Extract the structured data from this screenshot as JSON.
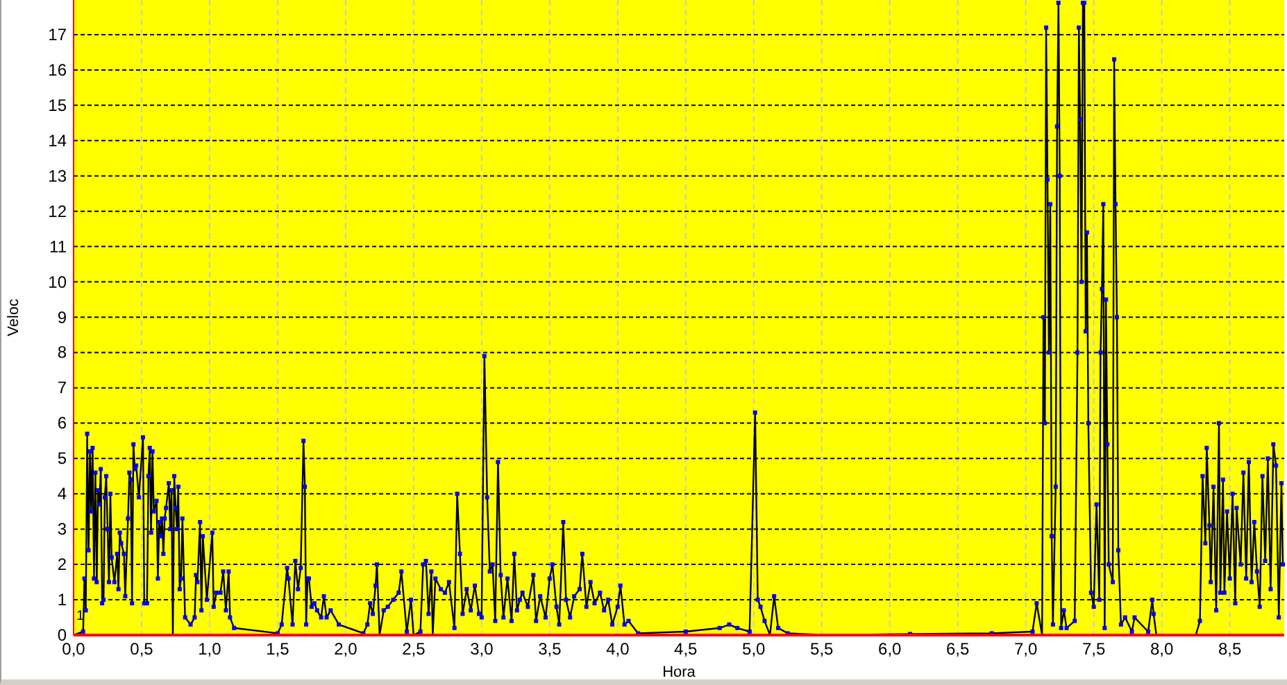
{
  "chart_data": {
    "type": "line",
    "xlabel": "Hora",
    "ylabel": "Veloc",
    "xlim": [
      0,
      8.9
    ],
    "ylim": [
      0,
      18
    ],
    "xticks": [
      {
        "value": 0,
        "label": "0,0"
      },
      {
        "value": 0.5,
        "label": "0,5"
      },
      {
        "value": 1,
        "label": "1,0"
      },
      {
        "value": 1.5,
        "label": "1,5"
      },
      {
        "value": 2,
        "label": "2,0"
      },
      {
        "value": 2.5,
        "label": "2,5"
      },
      {
        "value": 3,
        "label": "3,0"
      },
      {
        "value": 3.5,
        "label": "3,5"
      },
      {
        "value": 4,
        "label": "4,0"
      },
      {
        "value": 4.5,
        "label": "4,5"
      },
      {
        "value": 5,
        "label": "5,0"
      },
      {
        "value": 5.5,
        "label": "5,5"
      },
      {
        "value": 6,
        "label": "6,0"
      },
      {
        "value": 6.5,
        "label": "6,5"
      },
      {
        "value": 7,
        "label": "7,0"
      },
      {
        "value": 7.5,
        "label": "7,5"
      },
      {
        "value": 8,
        "label": "8,0"
      },
      {
        "value": 8.5,
        "label": "8,5"
      }
    ],
    "yticks": [
      0,
      1,
      2,
      3,
      4,
      5,
      6,
      7,
      8,
      9,
      10,
      11,
      12,
      13,
      14,
      15,
      16,
      17
    ],
    "x": [
      0,
      0.07,
      0.08,
      0.09,
      0.1,
      0.11,
      0.12,
      0.13,
      0.14,
      0.15,
      0.16,
      0.17,
      0.18,
      0.19,
      0.2,
      0.21,
      0.22,
      0.23,
      0.24,
      0.25,
      0.26,
      0.27,
      0.28,
      0.3,
      0.32,
      0.33,
      0.34,
      0.35,
      0.37,
      0.38,
      0.4,
      0.41,
      0.42,
      0.43,
      0.44,
      0.45,
      0.46,
      0.48,
      0.51,
      0.52,
      0.54,
      0.55,
      0.56,
      0.57,
      0.58,
      0.59,
      0.61,
      0.62,
      0.63,
      0.64,
      0.65,
      0.66,
      0.67,
      0.68,
      0.7,
      0.71,
      0.72,
      0.73,
      0.74,
      0.75,
      0.76,
      0.77,
      0.78,
      0.79,
      0.8,
      0.82,
      0.86,
      0.89,
      0.9,
      0.91,
      0.93,
      0.94,
      0.95,
      0.98,
      1.02,
      1.03,
      1.05,
      1.08,
      1.1,
      1.12,
      1.14,
      1.15,
      1.18,
      1.5,
      1.53,
      1.57,
      1.58,
      1.61,
      1.63,
      1.65,
      1.67,
      1.69,
      1.7,
      1.71,
      1.72,
      1.73,
      1.75,
      1.77,
      1.79,
      1.82,
      1.84,
      1.86,
      1.89,
      1.95,
      2.13,
      2.16,
      2.18,
      2.2,
      2.22,
      2.23,
      2.25,
      2.28,
      2.31,
      2.35,
      2.39,
      2.41,
      2.45,
      2.48,
      2.5,
      2.55,
      2.57,
      2.59,
      2.61,
      2.63,
      2.64,
      2.66,
      2.7,
      2.73,
      2.76,
      2.8,
      2.82,
      2.84,
      2.86,
      2.89,
      2.92,
      2.95,
      2.98,
      3,
      3.02,
      3.04,
      3.06,
      3.08,
      3.1,
      3.12,
      3.14,
      3.16,
      3.19,
      3.22,
      3.24,
      3.26,
      3.28,
      3.3,
      3.34,
      3.38,
      3.4,
      3.43,
      3.47,
      3.5,
      3.52,
      3.55,
      3.57,
      3.6,
      3.62,
      3.65,
      3.68,
      3.72,
      3.74,
      3.77,
      3.8,
      3.83,
      3.87,
      3.9,
      3.93,
      3.96,
      4,
      4.02,
      4.05,
      4.08,
      4.15,
      4.5,
      4.75,
      4.82,
      4.88,
      4.97,
      5.01,
      5.03,
      5.05,
      5.08,
      5.12,
      5.15,
      5.18,
      5.25,
      5.55,
      6.15,
      6.75,
      7.05,
      7.08,
      7.12,
      7.13,
      7.14,
      7.15,
      7.16,
      7.17,
      7.18,
      7.19,
      7.2,
      7.22,
      7.23,
      7.24,
      7.25,
      7.26,
      7.28,
      7.3,
      7.36,
      7.38,
      7.39,
      7.4,
      7.41,
      7.42,
      7.43,
      7.44,
      7.45,
      7.46,
      7.48,
      7.5,
      7.52,
      7.54,
      7.55,
      7.56,
      7.57,
      7.58,
      7.59,
      7.6,
      7.61,
      7.64,
      7.65,
      7.66,
      7.67,
      7.68,
      7.7,
      7.73,
      7.78,
      7.8,
      7.9,
      7.93,
      7.94,
      7.96,
      8.25,
      8.28,
      8.3,
      8.32,
      8.33,
      8.35,
      8.36,
      8.38,
      8.4,
      8.42,
      8.43,
      8.45,
      8.46,
      8.48,
      8.5,
      8.52,
      8.54,
      8.55,
      8.58,
      8.6,
      8.62,
      8.64,
      8.66,
      8.68,
      8.7,
      8.72,
      8.74,
      8.76,
      8.78,
      8.8,
      8.82,
      8.84,
      8.86,
      8.88,
      8.89
    ],
    "grid": true,
    "series": [
      {
        "name": "1",
        "color": "#000000",
        "marker": "square",
        "values": [
          0,
          0.1,
          1.6,
          0.7,
          5.7,
          2.4,
          5.2,
          3.5,
          5.3,
          1.6,
          4.6,
          1.5,
          4.1,
          3.7,
          4.7,
          0.9,
          1,
          3.9,
          4.5,
          3,
          1.5,
          4,
          2.2,
          1.5,
          2.3,
          1.3,
          2.9,
          2.6,
          2.3,
          1.1,
          3.3,
          4.6,
          4.4,
          0.9,
          5.4,
          4.7,
          4.8,
          3.9,
          5.6,
          0.9,
          0.9,
          4.5,
          5.3,
          2.9,
          5.2,
          3.5,
          3.8,
          1.6,
          3.2,
          2.8,
          3.3,
          2.3,
          3.3,
          3.6,
          4.3,
          3,
          4.1,
          0,
          4.5,
          3.6,
          3,
          4.2,
          1.3,
          1.6,
          3.3,
          0.5,
          0.3,
          0.5,
          1.7,
          1.5,
          3.2,
          0.7,
          2.8,
          1,
          2.9,
          0.8,
          1.2,
          1.2,
          1.8,
          0.7,
          1.8,
          0.5,
          0.2,
          0.05,
          0.3,
          1.9,
          1.6,
          0.3,
          2.1,
          1.3,
          1.9,
          5.5,
          4.2,
          0.3,
          1.6,
          1.6,
          0.8,
          0.9,
          0.7,
          0.5,
          1.1,
          0.5,
          0.7,
          0.3,
          0.05,
          0.3,
          0.9,
          0.6,
          1.4,
          2,
          0,
          0.7,
          0.8,
          1,
          1.2,
          1.8,
          0.1,
          1,
          0,
          0.1,
          2,
          2.1,
          0.6,
          1.8,
          0,
          1.6,
          1.3,
          1.2,
          1.5,
          0.2,
          4,
          2.3,
          0.6,
          1.3,
          0.7,
          1.4,
          0.6,
          0.5,
          7.9,
          3.9,
          1.8,
          2,
          0.4,
          4.9,
          1.7,
          0.5,
          1.6,
          0.4,
          2.3,
          0.7,
          1,
          1.2,
          0.8,
          1.7,
          0.4,
          1.1,
          0.5,
          1.6,
          2,
          0.8,
          0.3,
          3.2,
          1,
          0.5,
          1.1,
          1.3,
          2.3,
          0.8,
          1.5,
          0.9,
          1.2,
          0.7,
          1,
          0.3,
          0.8,
          1.4,
          0.3,
          0.4,
          0.05,
          0.1,
          0.2,
          0.3,
          0.2,
          0.1,
          6.3,
          1,
          0.8,
          0.4,
          0,
          1.1,
          0.2,
          0.05,
          0,
          0.03,
          0.05,
          0.1,
          0.9,
          0,
          9,
          6,
          17.2,
          12.9,
          8,
          12.2,
          2.8,
          0.3,
          4.2,
          14.4,
          17.9,
          13,
          0.2,
          0.7,
          0.2,
          0.4,
          8,
          17.2,
          14.6,
          10,
          17.9,
          17.9,
          8.6,
          11.4,
          6,
          1.2,
          0.8,
          3.7,
          1,
          8,
          9.8,
          12.2,
          0.2,
          9.5,
          5.4,
          2,
          1.5,
          16.3,
          12.2,
          9,
          2.4,
          0.3,
          0.5,
          0.1,
          0.5,
          0.1,
          1,
          0.6,
          0,
          0,
          0.4,
          4.5,
          2.6,
          5.3,
          3.1,
          1.5,
          4.2,
          0.7,
          6,
          1.2,
          4.4,
          1.2,
          3.5,
          1.6,
          4,
          0.9,
          3.6,
          2,
          4.6,
          1.6,
          4.9,
          1.5,
          3.2,
          1.8,
          0.8,
          4.5,
          2.1,
          5,
          1.3,
          5.4,
          4.8,
          0.5,
          4.3,
          2
        ]
      }
    ]
  }
}
